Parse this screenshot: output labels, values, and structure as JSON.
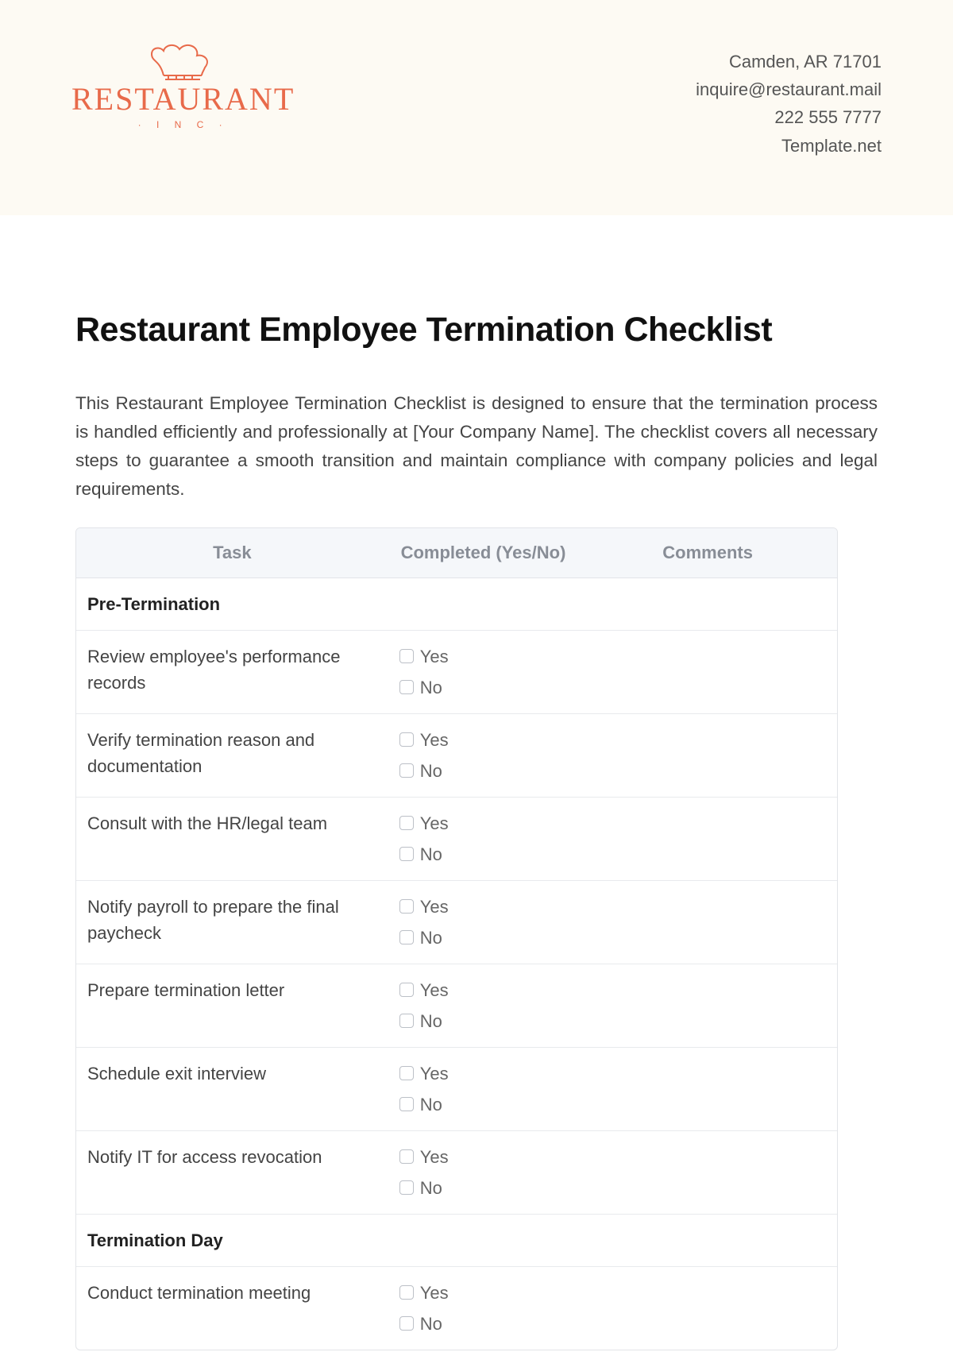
{
  "header": {
    "logo_main": "RESTAURANT",
    "logo_sub": "· I N C ·",
    "contact": {
      "address": "Camden, AR 71701",
      "email": "inquire@restaurant.mail",
      "phone": "222 555 7777",
      "site": "Template.net"
    }
  },
  "title": "Restaurant Employee Termination Checklist",
  "intro": "This Restaurant Employee Termination Checklist is designed to ensure that the termination process is handled efficiently and professionally at [Your Company Name]. The checklist covers all necessary steps to guarantee a smooth transition and maintain compliance with company policies and legal requirements.",
  "columns": {
    "task": "Task",
    "completed": "Completed (Yes/No)",
    "comments": "Comments"
  },
  "yn": {
    "yes": "Yes",
    "no": "No"
  },
  "rows": [
    {
      "type": "section",
      "label": "Pre-Termination"
    },
    {
      "type": "task",
      "label": "Review employee's performance records"
    },
    {
      "type": "task",
      "label": "Verify termination reason and documentation"
    },
    {
      "type": "task",
      "label": "Consult with the HR/legal team"
    },
    {
      "type": "task",
      "label": "Notify payroll to prepare the final paycheck"
    },
    {
      "type": "task",
      "label": "Prepare termination letter"
    },
    {
      "type": "task",
      "label": "Schedule exit interview"
    },
    {
      "type": "task",
      "label": "Notify IT for access revocation"
    },
    {
      "type": "section",
      "label": "Termination Day"
    },
    {
      "type": "task",
      "label": "Conduct termination meeting"
    }
  ]
}
